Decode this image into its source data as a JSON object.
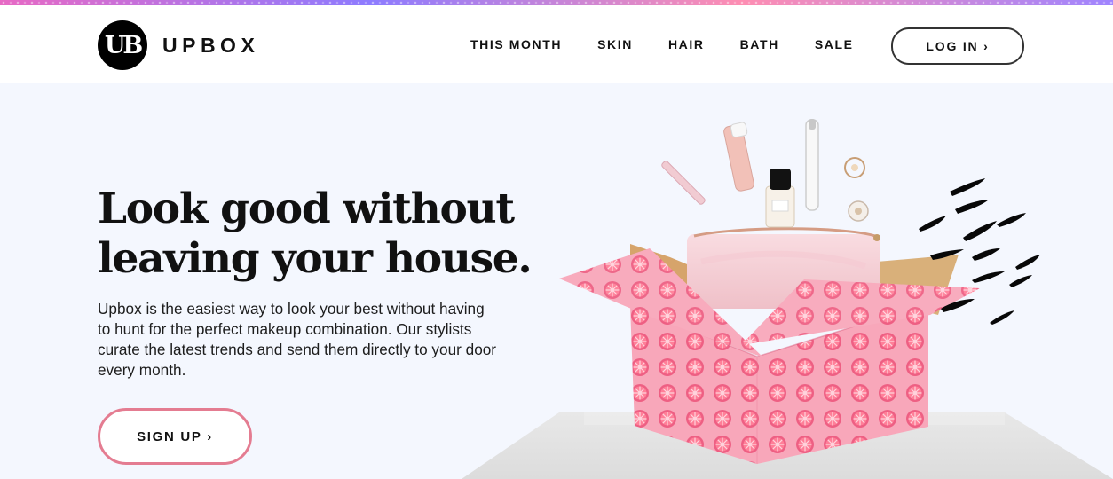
{
  "header": {
    "logo_mark": "UB",
    "brand": "UPBOX",
    "nav": [
      "THIS MONTH",
      "SKIN",
      "HAIR",
      "BATH",
      "SALE"
    ],
    "login_label": "LOG IN ›"
  },
  "hero": {
    "title": "Look good without\nleaving your house.",
    "description": "Upbox is the easiest way to look your best without having to hunt for the perfect makeup combination. Our stylists curate the latest trends and send them directly to your door every month.",
    "signup_label": "SIGN UP ›"
  },
  "colors": {
    "page_background": "#f4f7fe",
    "accent_pink": "#e47c91",
    "box_pink": "#f7a7b8",
    "header_background": "#ffffff",
    "text_dark": "#111111"
  },
  "icons": [
    "logo-mark-icon"
  ]
}
